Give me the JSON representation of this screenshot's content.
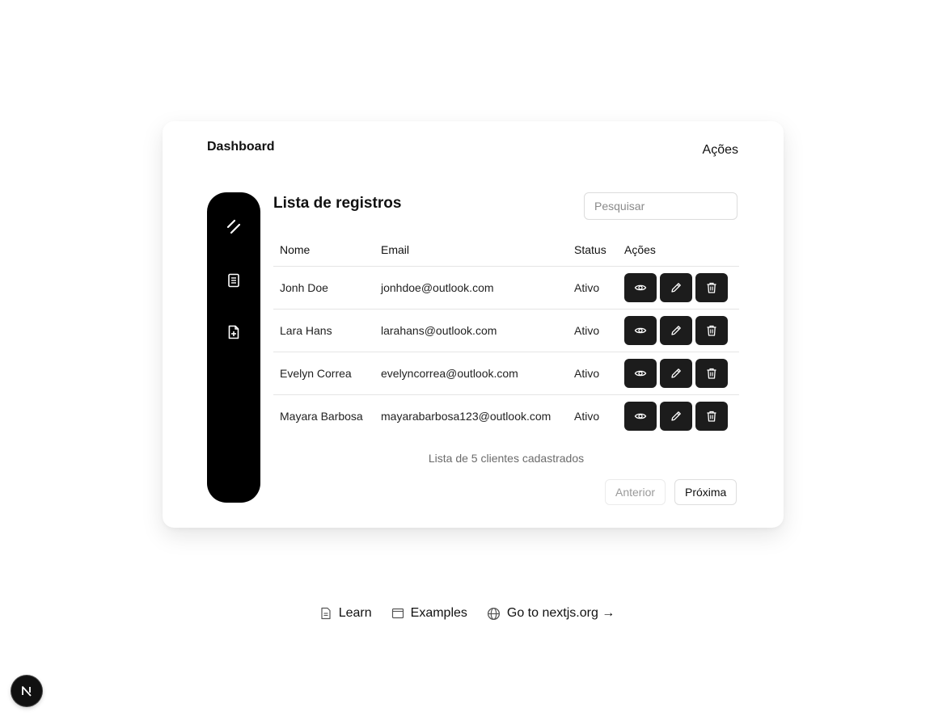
{
  "header": {
    "title": "Dashboard",
    "actions_label": "Ações"
  },
  "sidebar": {
    "items": [
      {
        "icon": "slash-logo-icon"
      },
      {
        "icon": "document-icon"
      },
      {
        "icon": "file-plus-icon"
      }
    ]
  },
  "main": {
    "title": "Lista de registros",
    "search_placeholder": "Pesquisar",
    "columns": [
      "Nome",
      "Email",
      "Status",
      "Ações"
    ],
    "rows": [
      {
        "name": "Jonh Doe",
        "email": "jonhdoe@outlook.com",
        "status": "Ativo"
      },
      {
        "name": "Lara Hans",
        "email": "larahans@outlook.com",
        "status": "Ativo"
      },
      {
        "name": "Evelyn Correa",
        "email": "evelyncorrea@outlook.com",
        "status": "Ativo"
      },
      {
        "name": "Mayara Barbosa",
        "email": "mayarabarbosa123@outlook.com",
        "status": "Ativo"
      }
    ],
    "row_actions": [
      "eye-icon",
      "pencil-icon",
      "trash-icon"
    ],
    "caption": "Lista de 5 clientes cadastrados",
    "prev_label": "Anterior",
    "next_label": "Próxima"
  },
  "footer_links": [
    {
      "label": "Learn",
      "icon": "file-icon"
    },
    {
      "label": "Examples",
      "icon": "window-icon"
    },
    {
      "label": "Go to nextjs.org →",
      "icon": "globe-icon"
    }
  ],
  "badge": {
    "letter": "N"
  },
  "colors": {
    "accent": "#000000",
    "action_button": "#1c1c1c",
    "muted_text": "#6b6b6b"
  }
}
